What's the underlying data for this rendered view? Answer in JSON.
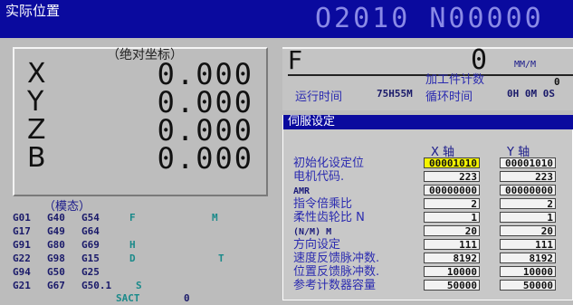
{
  "header": {
    "title": "实际位置",
    "program": "O2010 N00000"
  },
  "position": {
    "label": "（绝对坐标）",
    "axes": [
      {
        "name": "X",
        "value": "0.000"
      },
      {
        "name": "Y",
        "value": "0.000"
      },
      {
        "name": "Z",
        "value": "0.000"
      },
      {
        "name": "B",
        "value": "0.000"
      }
    ]
  },
  "feed": {
    "label": "F",
    "value": "0",
    "unit": "MM/M",
    "run_time_label": "运行时间",
    "run_time_value": "75H55M",
    "work_count_label": "加工件计数",
    "work_count_value": "0",
    "cycle_time_label": "循环时间",
    "cycle_time_value": "0H 0M 0S"
  },
  "servo": {
    "title": "伺服设定",
    "col_x": "X 轴",
    "col_y": "Y 轴",
    "rows": [
      {
        "label": "初始化设定位",
        "x": "00001010",
        "y": "00001010",
        "small": false
      },
      {
        "label": "电机代码.",
        "x": "223",
        "y": "223",
        "small": false
      },
      {
        "label": "AMR",
        "x": "00000000",
        "y": "00000000",
        "small": true
      },
      {
        "label": "指令倍乘比",
        "x": "2",
        "y": "2",
        "small": false
      },
      {
        "label": "柔性齿轮比 N",
        "x": "1",
        "y": "1",
        "small": false
      },
      {
        "label": "(N/M) M",
        "x": "20",
        "y": "20",
        "small": true
      },
      {
        "label": "方向设定",
        "x": "111",
        "y": "111",
        "small": false
      },
      {
        "label": "速度反馈脉冲数.",
        "x": "8192",
        "y": "8192",
        "small": false
      },
      {
        "label": "位置反馈脉冲数.",
        "x": "10000",
        "y": "10000",
        "small": false
      },
      {
        "label": "参考计数器容量",
        "x": "50000",
        "y": "50000",
        "small": false
      }
    ]
  },
  "modal": {
    "label": "（模态）",
    "rows": [
      {
        "c1": "G01",
        "c2": "G40",
        "c3": "G54",
        "c4": "F",
        "c5": "M"
      },
      {
        "c1": "G17",
        "c2": "G49",
        "c3": "G64",
        "c4": "",
        "c5": ""
      },
      {
        "c1": "G91",
        "c2": "G80",
        "c3": "G69",
        "c4": "H",
        "c5": ""
      },
      {
        "c1": "G22",
        "c2": "G98",
        "c3": "G15",
        "c4": "D",
        "c5": "T"
      },
      {
        "c1": "G94",
        "c2": "G50",
        "c3": "G25",
        "c4": "",
        "c5": ""
      },
      {
        "c1": "G21",
        "c2": "G67",
        "c3": "G50.1",
        "c4": "S",
        "c5": ""
      }
    ],
    "bottom_label": "SACT",
    "bottom_value": "0"
  }
}
